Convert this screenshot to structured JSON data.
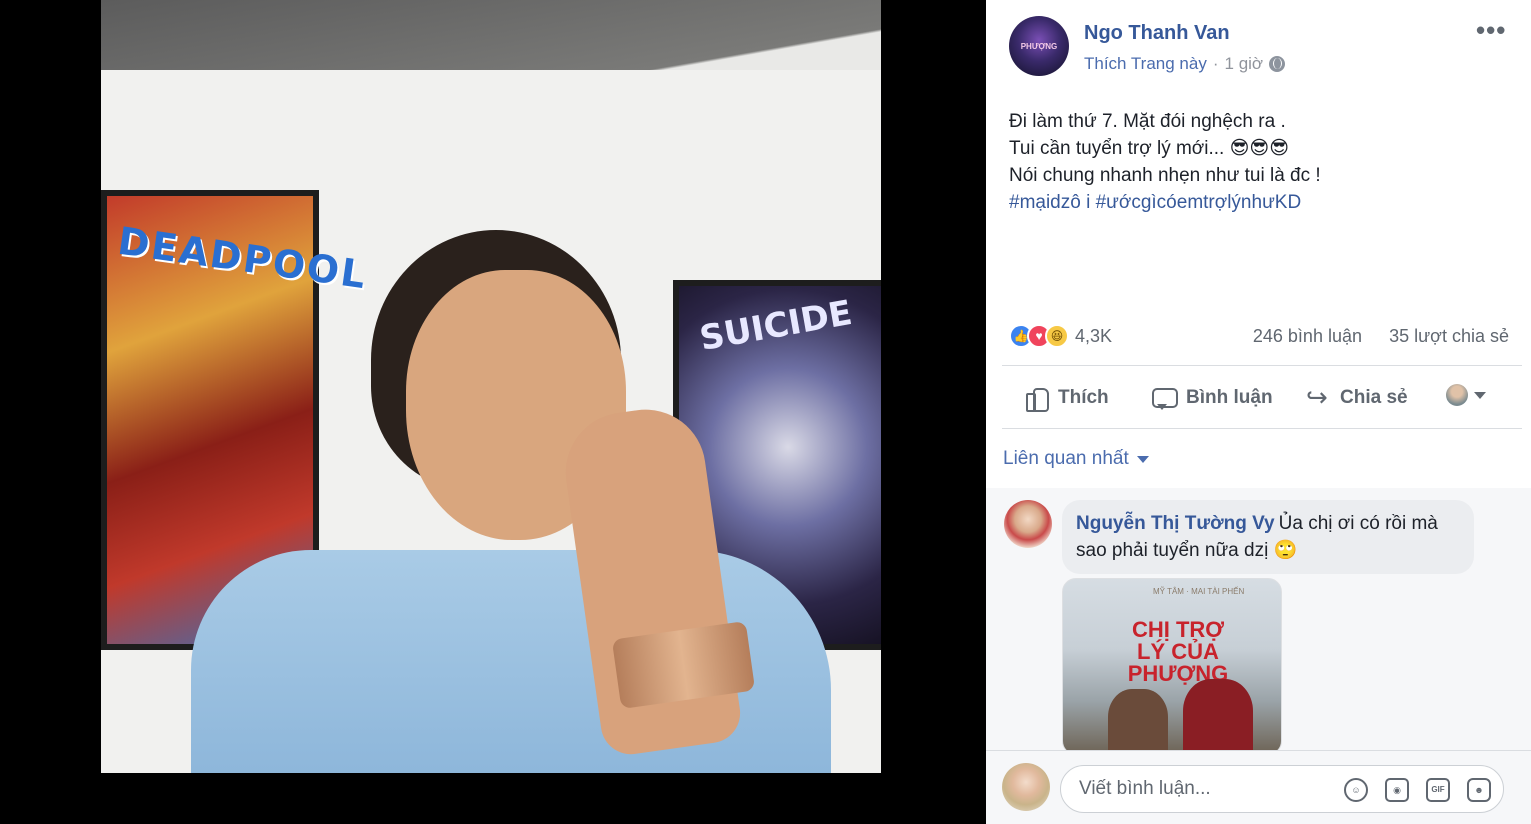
{
  "post": {
    "page_name": "Ngo Thanh Van",
    "avatar_text": "PHƯỢNG",
    "like_page": "Thích Trang này",
    "separator": "·",
    "time": "1 giờ",
    "more": "•••",
    "text_lines": [
      "Đi làm thứ 7. Mặt đói nghệch ra .",
      "Tui cần tuyển trợ lý mới... 😎😎😎",
      "Nói chung nhanh nhẹn như tui là đc !"
    ],
    "hashtags": "#mạidzô i #ướcgìcóemtrợlýnhưKD"
  },
  "photo": {
    "poster_left_title": "DEADPOOL",
    "poster_right_title": "SUICIDE"
  },
  "reactions": {
    "count": "4,3K",
    "comments": "246 bình luận",
    "shares": "35 lượt chia sẻ",
    "types": [
      "like-icon",
      "love-icon",
      "haha-icon"
    ]
  },
  "actions": {
    "like": "Thích",
    "comment": "Bình luận",
    "share": "Chia sẻ"
  },
  "sort_label": "Liên quan nhất",
  "comment": {
    "author": "Nguyễn Thị Tường Vy",
    "text": "Ủa chị ơi có rồi mà sao phải tuyển nữa dzị 🙄",
    "image_title": "CHỊ TRỢ LÝ CỦA PHƯỢNG",
    "image_subtitle": "MỸ TÂM · MAI TÀI PHẾN"
  },
  "composer": {
    "placeholder": "Viết bình luận...",
    "icons": [
      "emoji-icon",
      "camera-icon",
      "gif-icon",
      "sticker-icon"
    ]
  },
  "colors": {
    "link": "#365899",
    "muted": "#606770",
    "like_blue": "#3b83f0",
    "love_red": "#f0445c",
    "haha_yellow": "#f7c945"
  }
}
